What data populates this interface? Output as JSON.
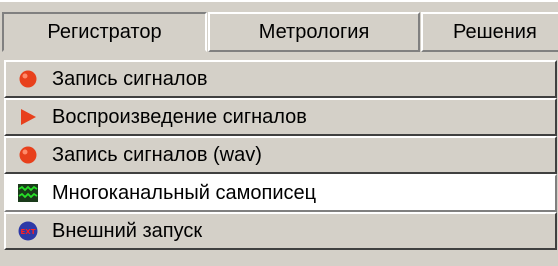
{
  "tabs": [
    {
      "label": "Регистратор",
      "active": true
    },
    {
      "label": "Метрология",
      "active": false
    },
    {
      "label": "Решения",
      "active": false
    }
  ],
  "menu": {
    "items": [
      {
        "label": "Запись сигналов",
        "icon": "record-icon"
      },
      {
        "label": "Воспроизведение сигналов",
        "icon": "play-icon"
      },
      {
        "label": "Запись сигналов (wav)",
        "icon": "record-wav-icon"
      },
      {
        "label": "Многоканальный самописец",
        "icon": "chart-recorder-icon",
        "selected": true
      },
      {
        "label": "Внешний запуск",
        "icon": "external-trigger-icon",
        "icon_text": "EXT"
      }
    ]
  },
  "colors": {
    "record": "#e8401c",
    "play": "#e8401c",
    "recorder_bg": "#1a3a1a",
    "recorder_line": "#27e027",
    "ext_bg": "#2d3aa8",
    "ext_text": "#ff2020",
    "selected_bg": "#ffffff"
  }
}
